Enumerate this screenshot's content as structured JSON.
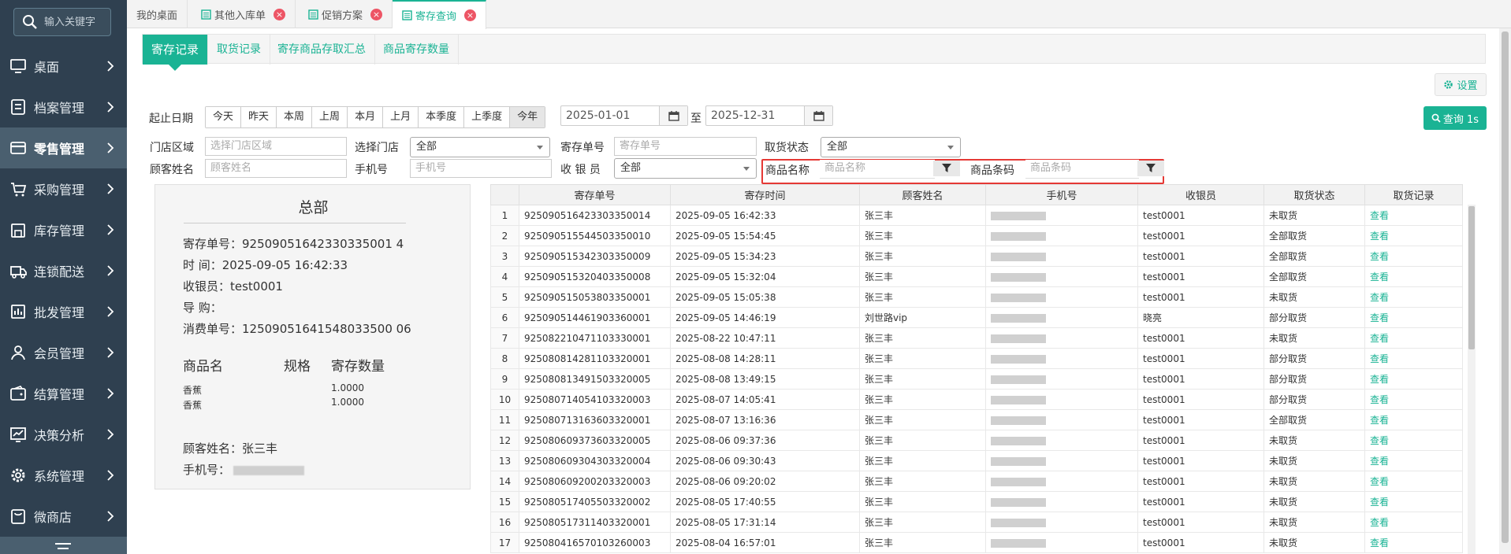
{
  "search": {
    "placeholder": "输入关键字"
  },
  "sidebar": {
    "items": [
      {
        "label": "桌面",
        "icon": "monitor-icon"
      },
      {
        "label": "档案管理",
        "icon": "archive-icon"
      },
      {
        "label": "零售管理",
        "icon": "card-icon",
        "active": true
      },
      {
        "label": "采购管理",
        "icon": "cart-icon"
      },
      {
        "label": "库存管理",
        "icon": "warehouse-icon"
      },
      {
        "label": "连锁配送",
        "icon": "truck-icon"
      },
      {
        "label": "批发管理",
        "icon": "wholesale-icon"
      },
      {
        "label": "会员管理",
        "icon": "user-icon"
      },
      {
        "label": "结算管理",
        "icon": "wallet-icon"
      },
      {
        "label": "决策分析",
        "icon": "chart-icon"
      },
      {
        "label": "系统管理",
        "icon": "gear-icon"
      },
      {
        "label": "微商店",
        "icon": "shop-icon"
      }
    ]
  },
  "top_tabs": [
    {
      "label": "我的桌面"
    },
    {
      "label": "其他入库单"
    },
    {
      "label": "促销方案"
    },
    {
      "label": "寄存查询",
      "active": true
    }
  ],
  "sub_tabs": [
    "寄存记录",
    "取货记录",
    "寄存商品存取汇总",
    "商品寄存数量"
  ],
  "toolbar": {
    "settings_label": "设置",
    "query_label": "查询 1s"
  },
  "filters": {
    "date_label": "起止日期",
    "date_buttons": [
      "今天",
      "昨天",
      "本周",
      "上周",
      "本月",
      "上月",
      "本季度",
      "上季度",
      "今年"
    ],
    "date_from": "2025-01-01",
    "date_to": "2025-12-31",
    "date_sep": "至",
    "store_area_label": "门店区域",
    "store_area_placeholder": "选择门店区域",
    "store_label": "选择门店",
    "store_value": "全部",
    "deposit_no_label": "寄存单号",
    "deposit_no_placeholder": "寄存单号",
    "pickup_status_label": "取货状态",
    "pickup_status_value": "全部",
    "customer_label": "顾客姓名",
    "customer_placeholder": "顾客姓名",
    "phone_label": "手机号",
    "phone_placeholder": "手机号",
    "cashier_label": "收 银 员",
    "cashier_value": "全部",
    "product_name_label": "商品名称",
    "product_name_placeholder": "商品名称",
    "barcode_label": "商品条码",
    "barcode_placeholder": "商品条码"
  },
  "receipt": {
    "title": "总部",
    "deposit_no_line": "寄存单号：92509051642330335001 4",
    "time_line": "时 间：2025-09-05 16:42:33",
    "cashier_line": "收银员：test0001",
    "guide_line": "导 购：",
    "consume_line": "消费单号：12509051641548033500 06",
    "col_name": "商品名",
    "col_spec": "规格",
    "col_qty": "寄存数量",
    "items": [
      {
        "name": "香蕉",
        "qty": "1.0000"
      },
      {
        "name": "香蕉",
        "qty": "1.0000"
      }
    ],
    "customer_line": "顾客姓名：张三丰",
    "phone_label": "手机号："
  },
  "table": {
    "columns": [
      "寄存单号",
      "寄存时间",
      "顾客姓名",
      "手机号",
      "收银员",
      "取货状态",
      "取货记录"
    ],
    "rows": [
      [
        "1",
        "925090516423303350014",
        "2025-09-05 16:42:33",
        "张三丰",
        "",
        "test0001",
        "未取货",
        "查看"
      ],
      [
        "2",
        "925090515544503350010",
        "2025-09-05 15:54:45",
        "张三丰",
        "",
        "test0001",
        "全部取货",
        "查看"
      ],
      [
        "3",
        "925090515342303350009",
        "2025-09-05 15:34:23",
        "张三丰",
        "",
        "test0001",
        "全部取货",
        "查看"
      ],
      [
        "4",
        "925090515320403350008",
        "2025-09-05 15:32:04",
        "张三丰",
        "",
        "test0001",
        "全部取货",
        "查看"
      ],
      [
        "5",
        "925090515053803350001",
        "2025-09-05 15:05:38",
        "张三丰",
        "",
        "test0001",
        "未取货",
        "查看"
      ],
      [
        "6",
        "925090514461903360001",
        "2025-09-05 14:46:19",
        "刘世路vip",
        "",
        "晓亮",
        "部分取货",
        "查看"
      ],
      [
        "7",
        "925082210471103330001",
        "2025-08-22 10:47:11",
        "张三丰",
        "",
        "test0001",
        "未取货",
        "查看"
      ],
      [
        "8",
        "925080814281103320001",
        "2025-08-08 14:28:11",
        "张三丰",
        "",
        "test0001",
        "部分取货",
        "查看"
      ],
      [
        "9",
        "925080813491503320005",
        "2025-08-08 13:49:15",
        "张三丰",
        "",
        "test0001",
        "部分取货",
        "查看"
      ],
      [
        "10",
        "925080714054103320003",
        "2025-08-07 14:05:41",
        "张三丰",
        "",
        "test0001",
        "部分取货",
        "查看"
      ],
      [
        "11",
        "925080713163603320001",
        "2025-08-07 13:16:36",
        "张三丰",
        "",
        "test0001",
        "全部取货",
        "查看"
      ],
      [
        "12",
        "925080609373603320005",
        "2025-08-06 09:37:36",
        "张三丰",
        "",
        "test0001",
        "未取货",
        "查看"
      ],
      [
        "13",
        "925080609304303320004",
        "2025-08-06 09:30:43",
        "张三丰",
        "",
        "test0001",
        "未取货",
        "查看"
      ],
      [
        "14",
        "925080609200203320003",
        "2025-08-06 09:20:02",
        "张三丰",
        "",
        "test0001",
        "未取货",
        "查看"
      ],
      [
        "15",
        "925080517405503320002",
        "2025-08-05 17:40:55",
        "张三丰",
        "",
        "test0001",
        "未取货",
        "查看"
      ],
      [
        "16",
        "925080517311403320001",
        "2025-08-05 17:31:14",
        "张三丰",
        "",
        "test0001",
        "未取货",
        "查看"
      ],
      [
        "17",
        "925080416570103260003",
        "2025-08-04 16:57:01",
        "张三丰",
        "",
        "test0001",
        "未取货",
        "查看"
      ]
    ]
  },
  "colors": {
    "accent": "#1ab394",
    "sidebar_bg": "#2f4050",
    "tab_close": "#ed5565",
    "highlight": "#e53935"
  }
}
